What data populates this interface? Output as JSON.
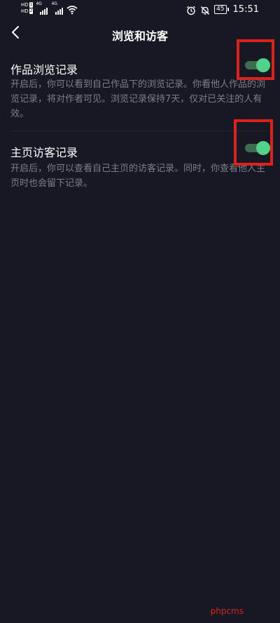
{
  "status_bar": {
    "hd1": "HD",
    "hd1_num": "1",
    "hd2": "HD",
    "hd2_num": "2",
    "network1": "4G",
    "network2": "4G",
    "battery_level": "45",
    "time": "15:51",
    "icons": [
      "wifi-icon",
      "alarm-icon",
      "mute-bell-icon",
      "battery-icon"
    ]
  },
  "header": {
    "title": "浏览和访客",
    "back_icon": "chevron-left-icon"
  },
  "settings": [
    {
      "title": "作品浏览记录",
      "description": "开启后，你可以看到自己作品下的浏览记录。你看他人作品的浏览记录，将对作者可见。浏览记录保持7天，仅对已关注的人有效。",
      "enabled": true
    },
    {
      "title": "主页访客记录",
      "description": "开启后，你可以查看自己主页的访客记录。同时，你查看他人主页时也会留下记录。",
      "enabled": true
    }
  ],
  "colors": {
    "background": "#161823",
    "toggle_on": "#53d38a",
    "highlight": "#e0201a",
    "secondary_text": "#7d7f87"
  },
  "watermark": "phpcms"
}
